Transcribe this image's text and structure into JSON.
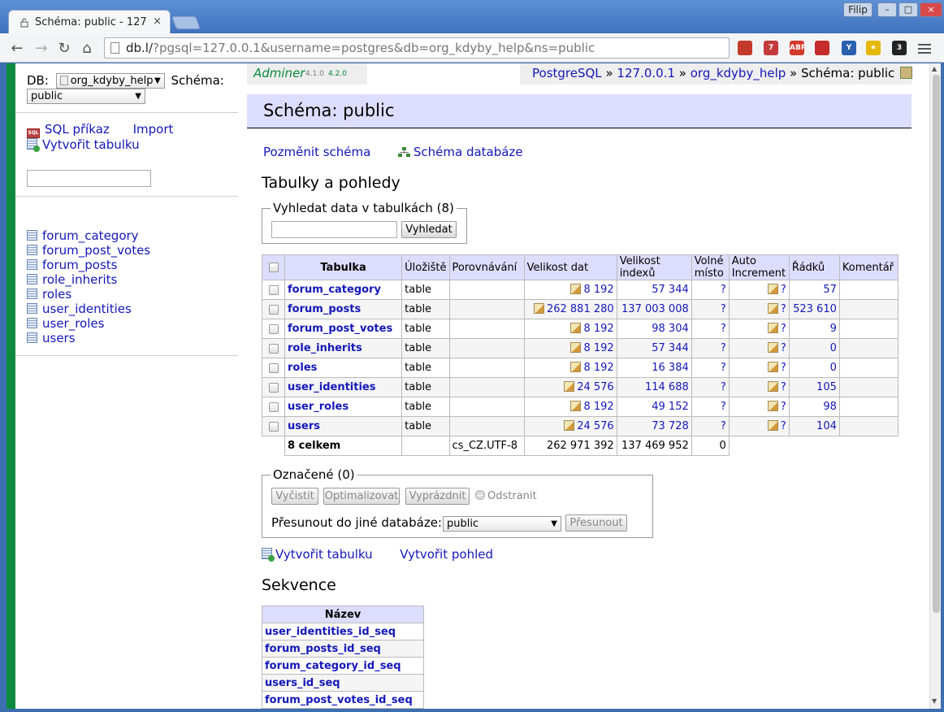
{
  "browser": {
    "tab_title": "Schéma: public - 127",
    "tab_close": "×",
    "user_badge": "Filip",
    "window_buttons": [
      "–",
      "□",
      "×"
    ],
    "url_host": "db.l/",
    "url_path": "?pgsql=127.0.0.1&username=postgres&db=org_kdyby_help&ns=public",
    "extensions": [
      {
        "name": "couch-icon",
        "label": "",
        "color": "#c33a2a"
      },
      {
        "name": "asterisk-extension-icon",
        "label": "7",
        "color": "#c43b3b"
      },
      {
        "name": "adblock-icon",
        "label": "ABP",
        "color": "#d43a2c"
      },
      {
        "name": "block-icon",
        "label": "",
        "color": "#c52b2b"
      },
      {
        "name": "y-extension-icon",
        "label": "Y",
        "color": "#2a5fb0"
      },
      {
        "name": "star-icon",
        "label": "★",
        "color": "#e6b800"
      },
      {
        "name": "github-icon",
        "label": "3",
        "color": "#222222"
      }
    ]
  },
  "menu": {
    "db_label": "DB:",
    "db_value": "org_kdyby_help",
    "schema_label": "Schéma:",
    "schema_value": "public",
    "sql_link": "SQL příkaz",
    "import_link": "Import",
    "create_table_link": "Vytvořit tabulku",
    "tables": [
      "forum_category",
      "forum_post_votes",
      "forum_posts",
      "role_inherits",
      "roles",
      "user_identities",
      "user_roles",
      "users"
    ]
  },
  "logo": {
    "name": "Adminer",
    "version_old": "4.1.0",
    "version_new": "4.2.0"
  },
  "breadcrumb": {
    "driver": "PostgreSQL",
    "server": "127.0.0.1",
    "database": "org_kdyby_help",
    "current": "Schéma: public",
    "sep": "»"
  },
  "title": "Schéma: public",
  "actions": {
    "alter_schema": "Pozměnit schéma",
    "db_schema": "Schéma databáze"
  },
  "tables_heading": "Tabulky a pohledy",
  "search": {
    "legend": "Vyhledat data v tabulkách (8)",
    "button": "Vyhledat"
  },
  "table_headers": [
    "Tabulka",
    "Úložiště",
    "Porovnávání",
    "Velikost dat",
    "Velikost indexů",
    "Volné místo",
    "Auto Increment",
    "Řádků",
    "Komentář"
  ],
  "rows": [
    {
      "name": "forum_category",
      "engine": "table",
      "collation": "",
      "data_length": "8 192",
      "index_length": "57 344",
      "data_free": "?",
      "auto_increment": "?",
      "rows": "57",
      "comment": ""
    },
    {
      "name": "forum_posts",
      "engine": "table",
      "collation": "",
      "data_length": "262 881 280",
      "index_length": "137 003 008",
      "data_free": "?",
      "auto_increment": "?",
      "rows": "523 610",
      "comment": ""
    },
    {
      "name": "forum_post_votes",
      "engine": "table",
      "collation": "",
      "data_length": "8 192",
      "index_length": "98 304",
      "data_free": "?",
      "auto_increment": "?",
      "rows": "9",
      "comment": ""
    },
    {
      "name": "role_inherits",
      "engine": "table",
      "collation": "",
      "data_length": "8 192",
      "index_length": "57 344",
      "data_free": "?",
      "auto_increment": "?",
      "rows": "0",
      "comment": ""
    },
    {
      "name": "roles",
      "engine": "table",
      "collation": "",
      "data_length": "8 192",
      "index_length": "16 384",
      "data_free": "?",
      "auto_increment": "?",
      "rows": "0",
      "comment": ""
    },
    {
      "name": "user_identities",
      "engine": "table",
      "collation": "",
      "data_length": "24 576",
      "index_length": "114 688",
      "data_free": "?",
      "auto_increment": "?",
      "rows": "105",
      "comment": ""
    },
    {
      "name": "user_roles",
      "engine": "table",
      "collation": "",
      "data_length": "8 192",
      "index_length": "49 152",
      "data_free": "?",
      "auto_increment": "?",
      "rows": "98",
      "comment": ""
    },
    {
      "name": "users",
      "engine": "table",
      "collation": "",
      "data_length": "24 576",
      "index_length": "73 728",
      "data_free": "?",
      "auto_increment": "?",
      "rows": "104",
      "comment": ""
    }
  ],
  "totals": {
    "label": "8 celkem",
    "collation": "cs_CZ.UTF-8",
    "data_length": "262 971 392",
    "index_length": "137 469 952",
    "data_free": "0"
  },
  "selected": {
    "legend": "Označené (0)",
    "analyze": "Vyčistit",
    "optimize": "Optimalizovat",
    "truncate": "Vyprázdnit",
    "drop": "Odstranit",
    "move_label": "Přesunout do jiné databáze:",
    "move_target": "public",
    "move_button": "Přesunout"
  },
  "bottom_links": {
    "create_table": "Vytvořit tabulku",
    "create_view": "Vytvořit pohled"
  },
  "sequences_heading": "Sekvence",
  "sequences_header": "Název",
  "sequences": [
    "user_identities_id_seq",
    "forum_posts_id_seq",
    "forum_category_id_seq",
    "users_id_seq",
    "forum_post_votes_id_seq"
  ]
}
